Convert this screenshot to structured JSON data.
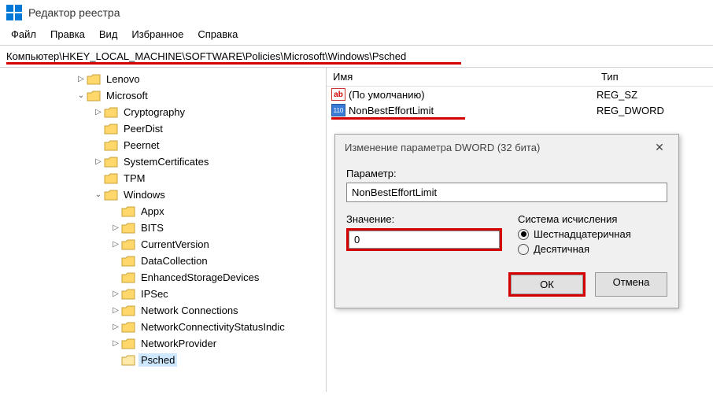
{
  "app": {
    "title": "Редактор реестра"
  },
  "menu": {
    "file": "Файл",
    "edit": "Правка",
    "view": "Вид",
    "favorites": "Избранное",
    "help": "Справка"
  },
  "address": "Компьютер\\HKEY_LOCAL_MACHINE\\SOFTWARE\\Policies\\Microsoft\\Windows\\Psched",
  "tree": {
    "lenovo": "Lenovo",
    "microsoft": "Microsoft",
    "ms_children": {
      "cryptography": "Cryptography",
      "peerdist": "PeerDist",
      "peernet": "Peernet",
      "systemcertificates": "SystemCertificates",
      "tpm": "TPM",
      "windows": "Windows"
    },
    "win_children": {
      "appx": "Appx",
      "bits": "BITS",
      "currentversion": "CurrentVersion",
      "datacollection": "DataCollection",
      "enhancedstorage": "EnhancedStorageDevices",
      "ipsec": "IPSec",
      "netconn": "Network Connections",
      "netconnstatus": "NetworkConnectivityStatusIndic",
      "networkprovider": "NetworkProvider",
      "psched": "Psched"
    }
  },
  "list": {
    "header_name": "Имя",
    "header_type": "Тип",
    "rows": [
      {
        "name": "(По умолчанию)",
        "type": "REG_SZ",
        "iconText": "ab",
        "iconBg": "#fff",
        "iconColor": "#d40000"
      },
      {
        "name": "NonBestEffortLimit",
        "type": "REG_DWORD",
        "iconText": "110",
        "iconBg": "#3a7bd5",
        "iconColor": "#fff"
      }
    ]
  },
  "dialog": {
    "title": "Изменение параметра DWORD (32 бита)",
    "param_label": "Параметр:",
    "param_value": "NonBestEffortLimit",
    "value_label": "Значение:",
    "value": "0",
    "base_label": "Система исчисления",
    "hex": "Шестнадцатеричная",
    "dec": "Десятичная",
    "ok": "ОК",
    "cancel": "Отмена"
  }
}
